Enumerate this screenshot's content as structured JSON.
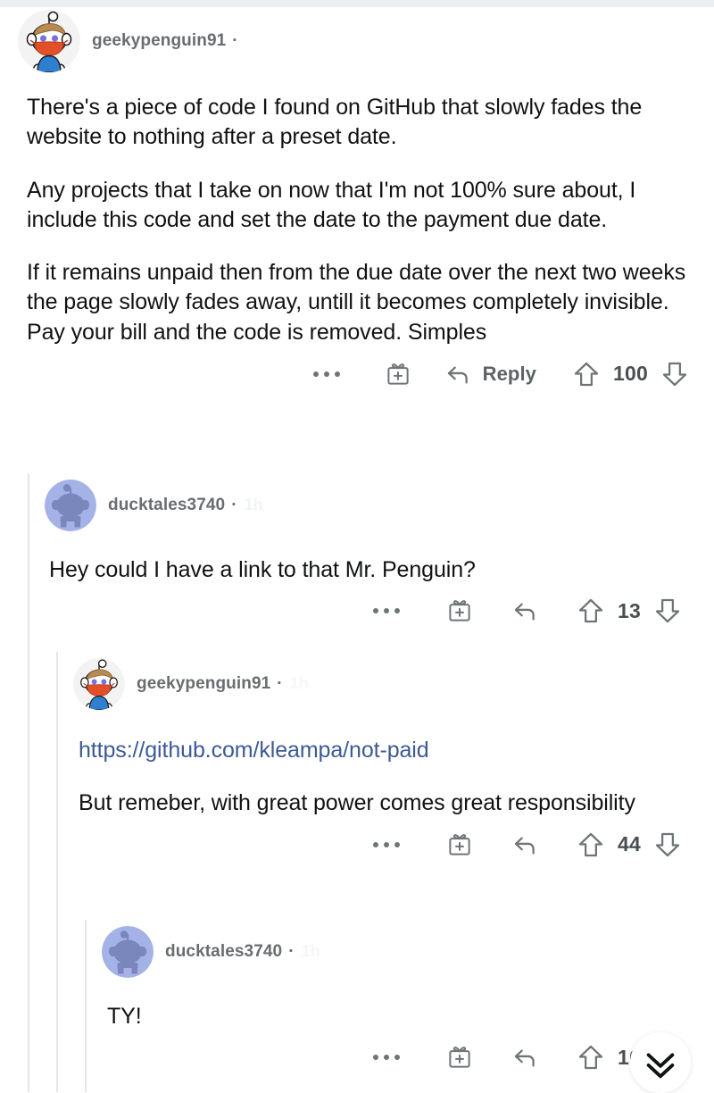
{
  "platform": "reddit-comment-thread",
  "comments": [
    {
      "id": "c1",
      "username": "geekypenguin91",
      "separator": "·",
      "timestamp": "",
      "avatar": "snoo-masked-avatar",
      "depth": 0,
      "paragraphs": [
        "There's a piece of code I found on GitHub that slowly fades the website to nothing after a preset date.",
        "Any projects that I take on now that I'm not 100% sure about, I include this code and set the date to the payment due date.",
        "If it remains unpaid then from the due date over the next two weeks the page slowly fades away, untill it becomes completely invisible. Pay your bill and the code is removed. Simples"
      ],
      "link": "",
      "actions": {
        "more_label": "more-options",
        "award_label": "Give Award",
        "reply_label": "Reply",
        "show_reply_label": true,
        "upvote_label": "upvote",
        "score": "100",
        "downvote_label": "downvote"
      }
    },
    {
      "id": "c2",
      "username": "ducktales3740",
      "separator": "·",
      "timestamp": "1h",
      "avatar": "snoo-default-avatar",
      "depth": 1,
      "paragraphs": [
        "Hey could I have a link to that Mr. Penguin?"
      ],
      "link": "",
      "actions": {
        "more_label": "more-options",
        "award_label": "Give Award",
        "reply_label": "Reply",
        "show_reply_label": false,
        "upvote_label": "upvote",
        "score": "13",
        "downvote_label": "downvote"
      }
    },
    {
      "id": "c3",
      "username": "geekypenguin91",
      "separator": "·",
      "timestamp": "1h",
      "avatar": "snoo-masked-avatar",
      "depth": 2,
      "paragraphs": [
        "But remeber, with great power comes great responsibility"
      ],
      "link": "https://github.com/kleampa/not-paid",
      "actions": {
        "more_label": "more-options",
        "award_label": "Give Award",
        "reply_label": "Reply",
        "show_reply_label": false,
        "upvote_label": "upvote",
        "score": "44",
        "downvote_label": "downvote"
      }
    },
    {
      "id": "c4",
      "username": "ducktales3740",
      "separator": "·",
      "timestamp": "1h",
      "avatar": "snoo-default-avatar",
      "depth": 3,
      "paragraphs": [
        "TY!"
      ],
      "link": "",
      "actions": {
        "more_label": "more-options",
        "award_label": "Give Award",
        "reply_label": "Reply",
        "show_reply_label": false,
        "upvote_label": "upvote",
        "score": "10",
        "downvote_label": "downvote"
      }
    }
  ],
  "floating_button": {
    "name": "next-thread-button",
    "icon": "double-chevron-down-icon"
  },
  "colors": {
    "link": "#3d5a96",
    "username": "#6a6d70",
    "body": "#111213",
    "icon": "#6f7477",
    "thread_line": "#e4e6e7",
    "avatar_default_bg": "#a5b2e8",
    "avatar_default_fg": "#7a87bd",
    "mask_red": "#e2502a",
    "shirt_blue": "#2f7fd1"
  }
}
